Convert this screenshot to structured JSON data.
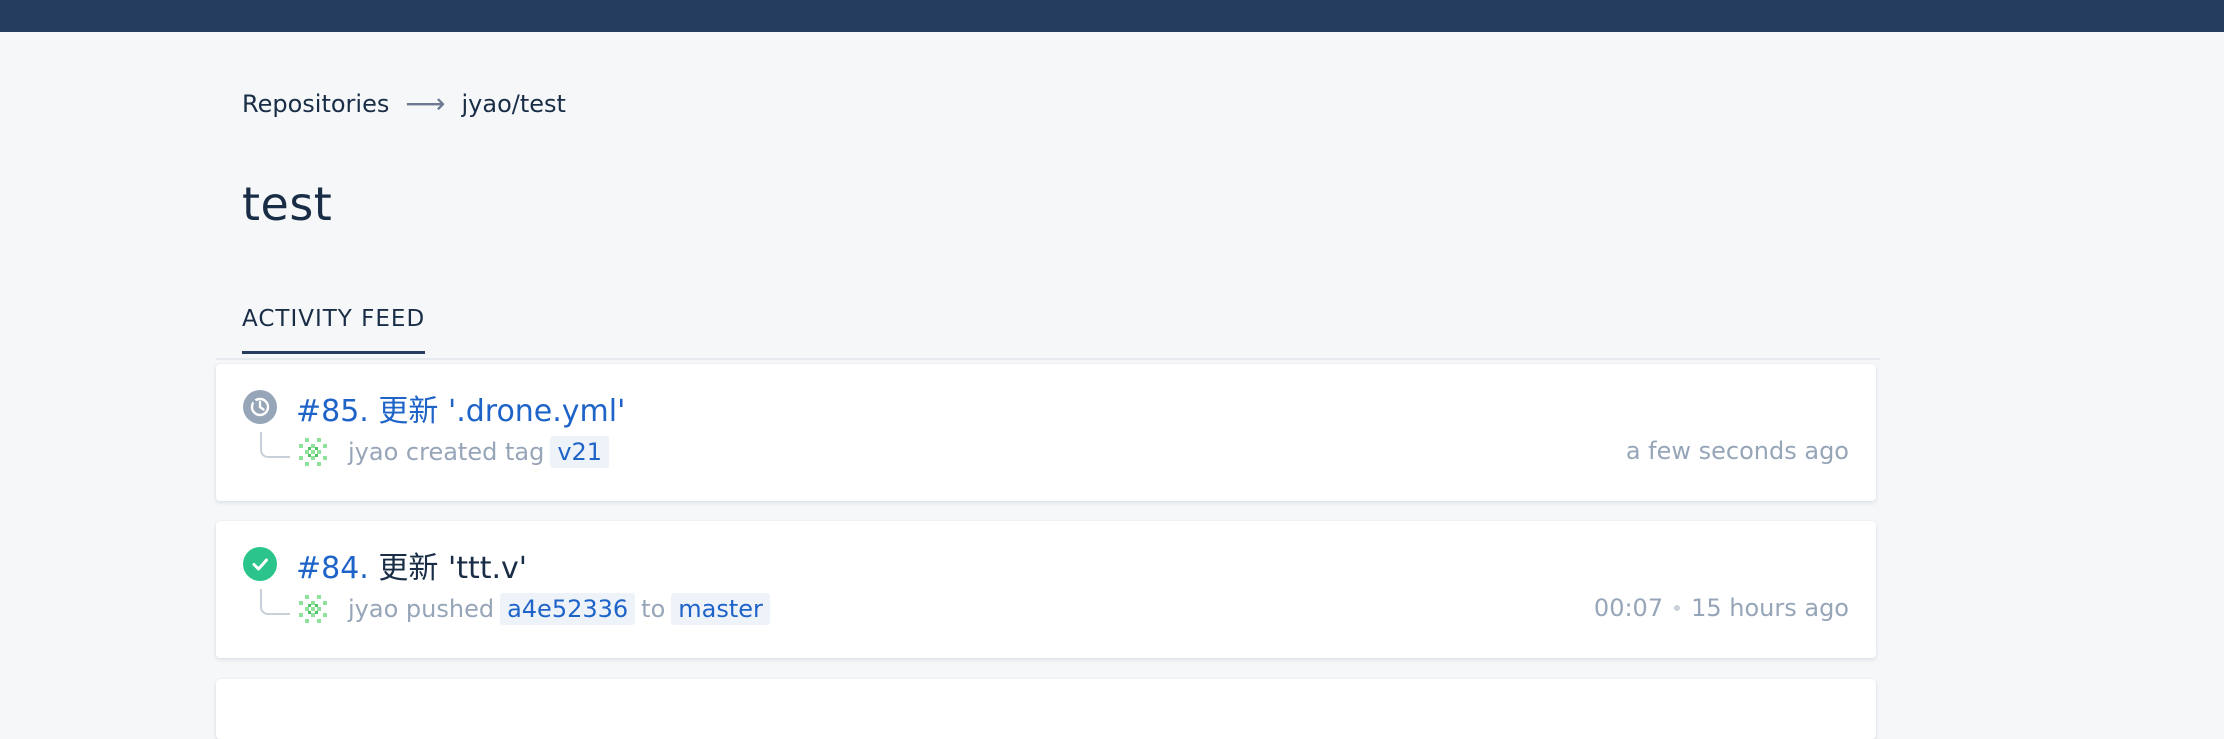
{
  "breadcrumb": {
    "root": "Repositories",
    "separator": "⟶",
    "current": "jyao/test"
  },
  "page": {
    "title": "test"
  },
  "tabs": [
    {
      "label": "ACTIVITY FEED",
      "active": true
    }
  ],
  "builds": [
    {
      "number": "#85.",
      "message": "更新 '.drone.yml'",
      "status": "running",
      "status_icon": "clock-icon",
      "status_color": "#96a5b8",
      "author": "jyao",
      "action": "created tag",
      "ref": "v21",
      "time": "a few seconds ago"
    },
    {
      "number": "#84.",
      "message": "更新 'ttt.v'",
      "status": "success",
      "status_icon": "check-icon",
      "status_color": "#2bc48a",
      "author": "jyao",
      "action": "pushed",
      "commit": "a4e52336",
      "to": "to",
      "branch": "master",
      "duration": "00:07",
      "time": "15 hours ago"
    }
  ],
  "colors": {
    "topbar": "#253d5e",
    "link": "#1e64c8",
    "muted": "#96a5b8",
    "background": "#f5f7f9"
  }
}
